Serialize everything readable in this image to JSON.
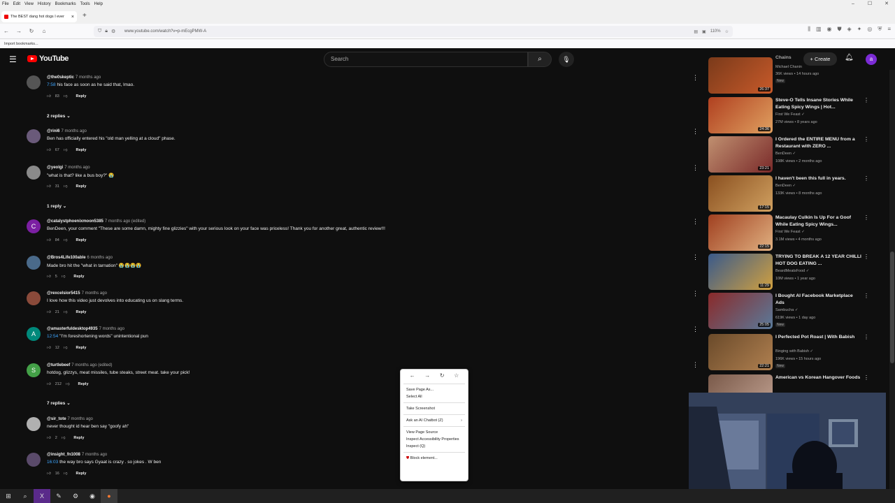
{
  "menubar": [
    "File",
    "Edit",
    "View",
    "History",
    "Bookmarks",
    "Tools",
    "Help"
  ],
  "tab": {
    "title": "The BEST dang hot dogs I ever"
  },
  "url": "www.youtube.com/watch?v=p-mEcgPMW-A",
  "zoom": "110%",
  "bookmarks": "Import bookmarks...",
  "yt": {
    "search_placeholder": "Search",
    "create": "Create",
    "avatar": "a"
  },
  "comments": [
    {
      "user": "@the0skeptic",
      "ago": "7 months ago",
      "ts": "7:58",
      "text": " his face as soon as he said that, lmao.",
      "likes": "83",
      "avatar": "",
      "color": "#555"
    },
    {
      "user": "@rini6",
      "ago": "7 months ago",
      "ts": "",
      "text": "Ben has officially entered his \"old man yelling at a cloud\" phase.",
      "likes": "67",
      "avatar": "",
      "color": "#6a5a7a"
    },
    {
      "user": "@yeolgi",
      "ago": "7 months ago",
      "ts": "",
      "text": "\"what is that? like a bus boy?\" 😭",
      "likes": "31",
      "avatar": "",
      "color": "#8a8a8a"
    },
    {
      "user": "@catalystphoenixmoon5385",
      "ago": "7 months ago (edited)",
      "ts": "",
      "text": "BenDeen, your comment \"These are some damn, mighty fine glizzies\" with your serious look on your face was priceless! Thank you for another great, authentic review!!!",
      "likes": "84",
      "avatar": "C",
      "color": "#7b1fa2"
    },
    {
      "user": "@Bros4Life100able",
      "ago": "6 months ago",
      "ts": "",
      "text": "Made bro hit the \"what in tarnation\" 😭😭😭😭",
      "likes": "5",
      "avatar": "",
      "color": "#4a6a8a"
    },
    {
      "user": "@rexcelsior5415",
      "ago": "7 months ago",
      "ts": "",
      "text": "I love how this video just devolves into educating us on slang terms.",
      "likes": "21",
      "avatar": "",
      "color": "#8a4a3a"
    },
    {
      "user": "@amasterfuldesktop4935",
      "ago": "7 months ago",
      "ts": "12:54",
      "text": " \"I'm foreshortening words\" unintentional pun",
      "likes": "12",
      "avatar": "A",
      "color": "#00897b"
    },
    {
      "user": "@turtlebeef",
      "ago": "7 months ago (edited)",
      "ts": "",
      "text": "hotdog, glizzys, meat missiles, tube steaks, street meat. take your pick!",
      "likes": "212",
      "avatar": "S",
      "color": "#43a047"
    },
    {
      "user": "@sir_tote",
      "ago": "7 months ago",
      "ts": "",
      "text": "never thought id hear ben say \"goofy ah\"",
      "likes": "2",
      "avatar": "",
      "color": "#b0b0b0"
    },
    {
      "user": "@insight_fn1008",
      "ago": "7 months ago",
      "ts": "16:03",
      "text": " the way bro says Gyaat is crazy . so jokes . W ben",
      "likes": "16",
      "avatar": "",
      "color": "#5a4a6a"
    }
  ],
  "reply_toggles": [
    "2 replies",
    "1 reply",
    "7 replies"
  ],
  "reply_label": "Reply",
  "recs": [
    {
      "title": "",
      "channel": "Michael Chanin",
      "meta": "36K views • 14 hours ago",
      "new": "New",
      "dur": "26:37",
      "c1": "#7a3a1a",
      "c2": "#c85a2a"
    },
    {
      "title": "Steve-O Tells Insane Stories While Eating Spicy Wings | Hot...",
      "channel": "First We Feast",
      "meta": "27M views • 8 years ago",
      "new": "",
      "dur": "24:36",
      "c1": "#b04020",
      "c2": "#e0a060"
    },
    {
      "title": "I Ordered the ENTIRE MENU from a Restaurant with ZERO ...",
      "channel": "BenDeen",
      "meta": "108K views • 2 months ago",
      "new": "",
      "dur": "23:21",
      "c1": "#c09070",
      "c2": "#7a2a2a"
    },
    {
      "title": "I haven't been this full in years.",
      "channel": "BenDeen",
      "meta": "133K views • 8 months ago",
      "new": "",
      "dur": "17:15",
      "c1": "#8a5020",
      "c2": "#d0a060"
    },
    {
      "title": "Macaulay Culkin Is Up For a Goof While Eating Spicy Wings...",
      "channel": "First We Feast",
      "meta": "3.1M views • 4 months ago",
      "new": "",
      "dur": "22:15",
      "c1": "#a04020",
      "c2": "#e0b080"
    },
    {
      "title": "TRYING TO BREAK A 12 YEAR CHILLI HOT DOG EATING ...",
      "channel": "BeardMeatsFood",
      "meta": "10M views • 1 year ago",
      "new": "",
      "dur": "11:29",
      "c1": "#3a5a8a",
      "c2": "#d0a040"
    },
    {
      "title": "I Bought AI Facebook Marketplace Ads",
      "channel": "Sambucha",
      "meta": "619K views • 1 day ago",
      "new": "New",
      "dur": "25:05",
      "c1": "#8a2a2a",
      "c2": "#5a7a9a"
    },
    {
      "title": "I Perfected Pot Roast | With Babish",
      "channel": "Binging with Babish",
      "meta": "196K views • 15 hours ago",
      "new": "New",
      "dur": "22:21",
      "c1": "#6a4a2a",
      "c2": "#b08050"
    },
    {
      "title": "American vs Korean Hangover Foods",
      "channel": "",
      "meta": "",
      "new": "",
      "dur": "",
      "c1": "#7a5a4a",
      "c2": "#c0a090"
    }
  ],
  "rec_partial_title": "Chains",
  "context_menu": {
    "items": [
      "Save Page As...",
      "Select All",
      "Take Screenshot",
      "Ask an AI Chatbot (Z)",
      "View Page Source",
      "Inspect Accessibility Properties",
      "Inspect (Q)",
      "Block element..."
    ]
  }
}
